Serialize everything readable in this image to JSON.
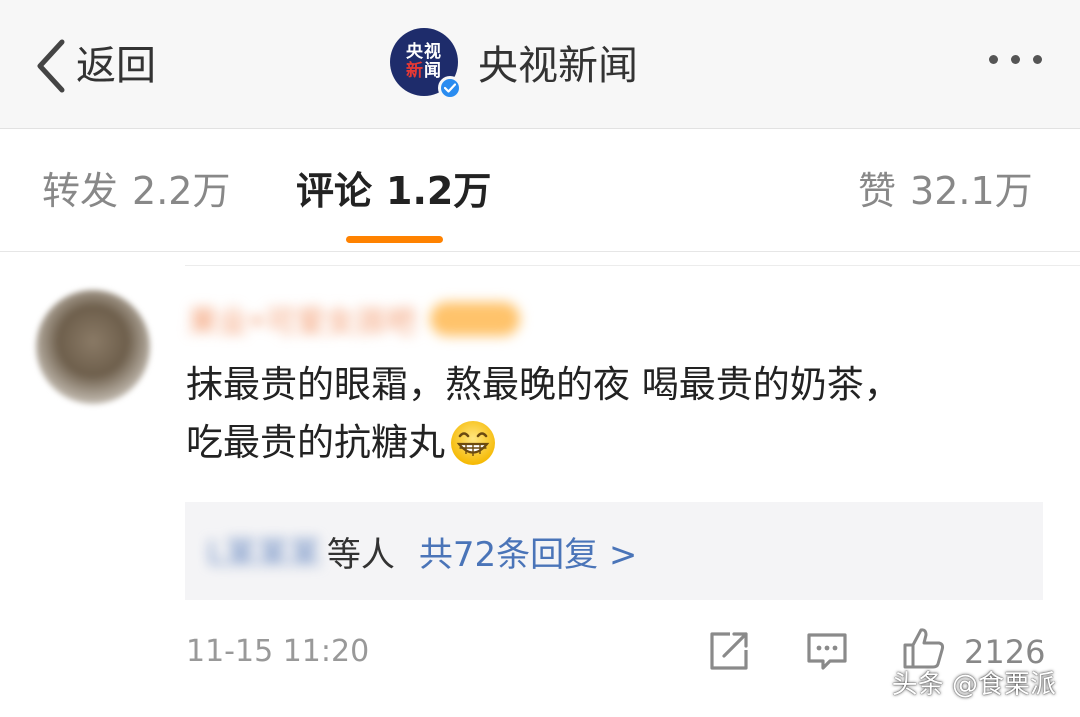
{
  "header": {
    "back_label": "返回",
    "account_name": "央视新闻",
    "logo_text_top": "央视",
    "logo_text_bottom_a": "新",
    "logo_text_bottom_b": "闻",
    "more_icon": "more-dots-icon"
  },
  "tabs": [
    {
      "label": "转发",
      "count": "2.2万",
      "active": false
    },
    {
      "label": "评论",
      "count": "1.2万",
      "active": true
    },
    {
      "label": "赞",
      "count": "32.1万",
      "active": false
    }
  ],
  "comment": {
    "username": "果业•可爱女孩吧",
    "text_line1": "抹最贵的眼霜，熬最晚的夜 喝最贵的奶茶，",
    "text_line2": "吃最贵的抗糖丸",
    "emoji": "grinning-face-icon",
    "reply_user": "L某某某",
    "reply_etc": "等人",
    "reply_count": "共72条回复 >",
    "time": "11-15 11:20",
    "like_count": "2126"
  },
  "watermark": "头条 @食栗派",
  "colors": {
    "accent": "#ff8200",
    "link": "#4a74b8",
    "header_bg": "#f7f7f7"
  }
}
